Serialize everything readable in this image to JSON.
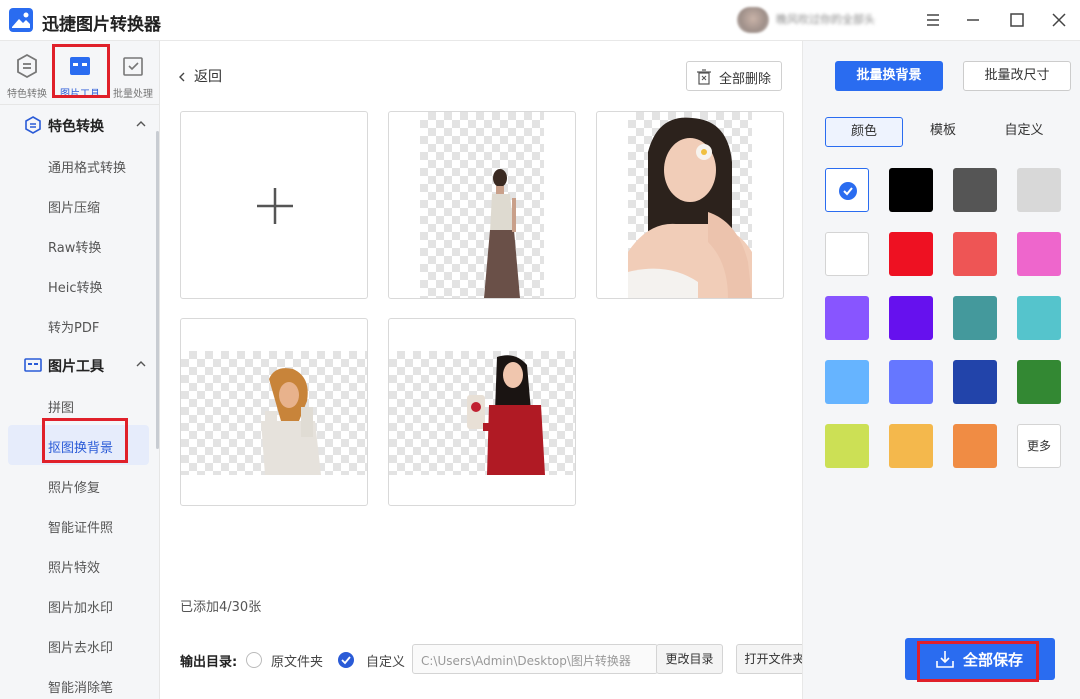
{
  "app": {
    "title": "迅捷图片转换器",
    "user_name": "晚风吹过你的全部头"
  },
  "rail_tabs": [
    {
      "label": "特色转换"
    },
    {
      "label": "图片工具"
    },
    {
      "label": "批量处理"
    }
  ],
  "nav": {
    "groups": [
      {
        "title": "特色转换",
        "items": [
          "通用格式转换",
          "图片压缩",
          "Raw转换",
          "Heic转换",
          "转为PDF"
        ]
      },
      {
        "title": "图片工具",
        "items": [
          "拼图",
          "抠图换背景",
          "照片修复",
          "智能证件照",
          "照片特效",
          "图片加水印",
          "图片去水印",
          "智能消除笔"
        ]
      }
    ],
    "active_item": "抠图换背景"
  },
  "main": {
    "back_label": "返回",
    "delete_all_label": "全部删除",
    "added_count": "已添加4/30张",
    "output": {
      "label": "输出目录:",
      "option_original": "原文件夹",
      "option_custom": "自定义",
      "selected": "自定义",
      "path": "C:\\Users\\Admin\\Desktop\\图片转换器",
      "change_dir_label": "更改目录",
      "open_folder_label": "打开文件夹"
    }
  },
  "panel": {
    "batch_bg_label": "批量换背景",
    "batch_resize_label": "批量改尺寸",
    "subtabs": [
      "颜色",
      "模板",
      "自定义"
    ],
    "active_subtab": "颜色",
    "swatches": [
      "transparent",
      "#000000",
      "#555555",
      "#d8d8d8",
      "#ffffff",
      "#ee1122",
      "#ee5555",
      "#ee66cc",
      "#8855ff",
      "#6611ee",
      "#44999c",
      "#55c4cc",
      "#66b4ff",
      "#6677ff",
      "#2244aa",
      "#338833",
      "#cce055",
      "#f4b84c",
      "#f08c44"
    ],
    "more_label": "更多",
    "save_all_label": "全部保存"
  },
  "colors": {
    "accent": "#2a6cf0",
    "highlight": "#e0202a"
  }
}
